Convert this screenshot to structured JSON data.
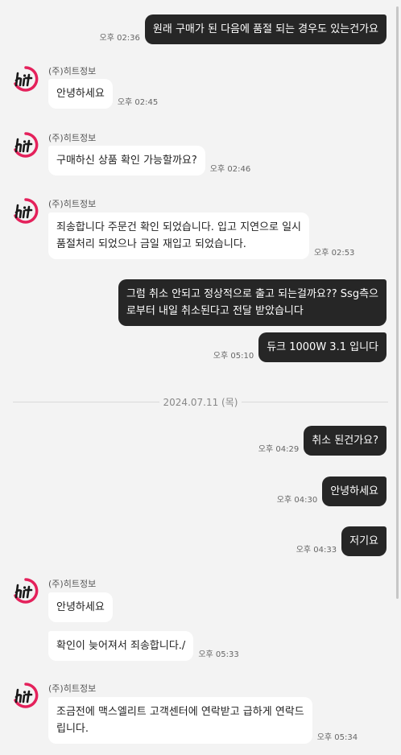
{
  "sender_name": "(주)히트정보",
  "date_divider": "2024.07.11 (목)",
  "messages": [
    {
      "text": "원래 구매가 된 다음에 품절 되는 경우도 있는건가요",
      "time": "오후 02:36"
    },
    {
      "text": "안녕하세요",
      "time": "오후 02:45"
    },
    {
      "text": "구매하신 상품 확인 가능할까요?",
      "time": "오후 02:46"
    },
    {
      "line1": "죄송합니다 주문건 확인 되었습니다. 입고 지연으로 일시",
      "line2": "품절처리 되었으나 금일 재입고 되었습니다.",
      "time": "오후 02:53"
    },
    {
      "line1": "그럼 취소 안되고 정상적으로 출고 되는걸까요?? Ssg측으",
      "line2": "로부터 내일 취소된다고 전달 받았습니다"
    },
    {
      "text": "듀크 1000W 3.1 입니다",
      "time": "오후 05:10"
    },
    {
      "text": "취소 된건가요?",
      "time": "오후 04:29"
    },
    {
      "text": "안녕하세요",
      "time": "오후 04:30"
    },
    {
      "text": "저기요",
      "time": "오후 04:33"
    },
    {
      "text": "안녕하세요"
    },
    {
      "text": "확인이 늦어져서 죄송합니다./",
      "time": "오후 05:33"
    },
    {
      "line1": "조금전에 맥스엘리트 고객센터에 연락받고 급하게 연락드",
      "line2": "립니다.",
      "time": "오후 05:34"
    }
  ],
  "colors": {
    "logo_pink": "#e4215b",
    "outgoing_bubble": "#262626",
    "incoming_bubble": "#ffffff",
    "background": "#f3f3f3"
  },
  "avatar_icon": "hit-logo-icon"
}
